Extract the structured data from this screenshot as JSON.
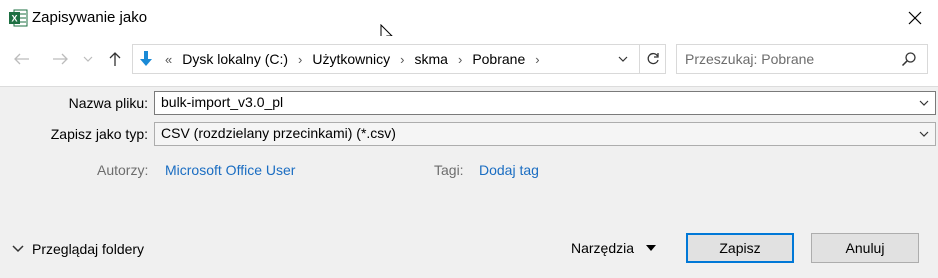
{
  "window": {
    "title": "Zapisywanie jako",
    "app_icon": "excel-icon"
  },
  "nav": {
    "breadcrumb_overflow": "«",
    "breadcrumbs": [
      "Dysk lokalny (C:)",
      "Użytkownicy",
      "skma",
      "Pobrane"
    ],
    "search_placeholder": "Przeszukaj: Pobrane"
  },
  "form": {
    "filename_label": "Nazwa pliku:",
    "filename_value": "bulk-import_v3.0_pl",
    "filetype_label": "Zapisz jako typ:",
    "filetype_value": "CSV (rozdzielany przecinkami) (*.csv)",
    "authors_label": "Autorzy:",
    "authors_value": "Microsoft Office User",
    "tags_label": "Tagi:",
    "tags_value": "Dodaj tag"
  },
  "footer": {
    "browse_folders": "Przeglądaj foldery",
    "tools": "Narzędzia",
    "save": "Zapisz",
    "cancel": "Anuluj"
  },
  "colors": {
    "accent": "#0078d7",
    "link": "#1a6dc2",
    "excel_green": "#1d6f42",
    "form_bg": "#f0f0f0"
  }
}
